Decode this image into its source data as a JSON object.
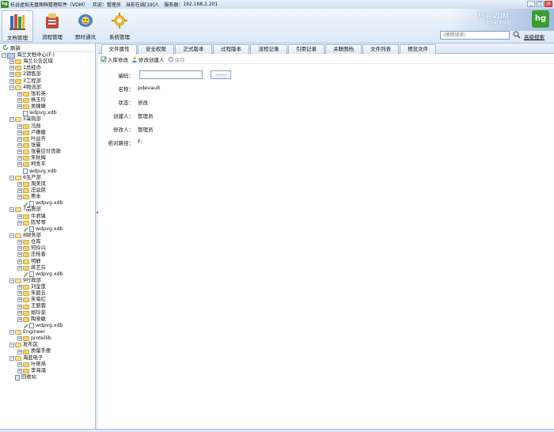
{
  "window": {
    "title": "杭谷虚拟无盘图档管理软件（VDM）",
    "welcome": "欢迎：管理员",
    "online": "当前在线[19]人",
    "server_label": "服务器：",
    "server": "192.168.2.201",
    "min": "_",
    "max": "□",
    "close": "×"
  },
  "toolbar": {
    "buttons": [
      {
        "label": "文档管理",
        "icon": "books-icon"
      },
      {
        "label": "流程管理",
        "icon": "flow-icon"
      },
      {
        "label": "即时通讯",
        "icon": "chat-icon"
      },
      {
        "label": "系统管理",
        "icon": "system-icon"
      }
    ],
    "brand_name": "杭谷VDM",
    "brand_sub": "智能新 新体验",
    "brand_logo": "hg",
    "search_placeholder": "(模糊搜索)",
    "advanced_search": "高级搜索"
  },
  "left": {
    "refresh": "刷新"
  },
  "tree": [
    {
      "level": 0,
      "label": "海兰文档中心(F:)",
      "type": "root",
      "exp": "-"
    },
    {
      "level": 1,
      "label": "海兰公告区域",
      "type": "folder",
      "exp": "+"
    },
    {
      "level": 1,
      "label": "1总经办",
      "type": "folder",
      "exp": "+"
    },
    {
      "level": 1,
      "label": "2销售部",
      "type": "folder",
      "exp": "+"
    },
    {
      "level": 1,
      "label": "3工程部",
      "type": "folder",
      "exp": "+"
    },
    {
      "level": 1,
      "label": "4物流部",
      "type": "folder-open",
      "exp": "-"
    },
    {
      "level": 2,
      "label": "张彩英",
      "type": "folder",
      "exp": "+"
    },
    {
      "level": 2,
      "label": "杨玉玲",
      "type": "folder",
      "exp": "+"
    },
    {
      "level": 2,
      "label": "吴婕婕",
      "type": "folder",
      "exp": "+"
    },
    {
      "level": 2,
      "label": "wdpvg.xdb",
      "type": "doc",
      "exp": ""
    },
    {
      "level": 1,
      "label": "5采购部",
      "type": "folder-open",
      "exp": "-"
    },
    {
      "level": 2,
      "label": "冯勋",
      "type": "folder",
      "exp": "+"
    },
    {
      "level": 2,
      "label": "卢嫩媛",
      "type": "folder",
      "exp": "+"
    },
    {
      "level": 2,
      "label": "叶益芳",
      "type": "folder",
      "exp": "+"
    },
    {
      "level": 2,
      "label": "张曼",
      "type": "folder",
      "exp": "+"
    },
    {
      "level": 2,
      "label": "张曼应付货款",
      "type": "folder",
      "exp": "+"
    },
    {
      "level": 2,
      "label": "朱秋梅",
      "type": "folder",
      "exp": "+"
    },
    {
      "level": 2,
      "label": "柯秀平",
      "type": "folder",
      "exp": "+"
    },
    {
      "level": 2,
      "label": "wdpvg.xdb",
      "type": "doc",
      "exp": ""
    },
    {
      "level": 1,
      "label": "6生产部",
      "type": "folder-open",
      "exp": "-"
    },
    {
      "level": 2,
      "label": "周美凤",
      "type": "folder",
      "exp": "+"
    },
    {
      "level": 2,
      "label": "庄益民",
      "type": "folder",
      "exp": "+"
    },
    {
      "level": 2,
      "label": "票本",
      "type": "folder",
      "exp": "+"
    },
    {
      "level": 2,
      "label": "wdpvg.xdb",
      "type": "pencil-doc",
      "exp": ""
    },
    {
      "level": 1,
      "label": "7品质部",
      "type": "folder-open",
      "exp": "-"
    },
    {
      "level": 2,
      "label": "牛君锋",
      "type": "folder",
      "exp": "+"
    },
    {
      "level": 2,
      "label": "陈琴琴",
      "type": "folder",
      "exp": "+"
    },
    {
      "level": 2,
      "label": "wdpvg.xdb",
      "type": "pencil-doc",
      "exp": ""
    },
    {
      "level": 1,
      "label": "8财务部",
      "type": "folder-open",
      "exp": "-"
    },
    {
      "level": 2,
      "label": "仓库",
      "type": "folder",
      "exp": "+"
    },
    {
      "level": 2,
      "label": "何伶兴",
      "type": "folder",
      "exp": "+"
    },
    {
      "level": 2,
      "label": "庄桂香",
      "type": "folder",
      "exp": "+"
    },
    {
      "level": 2,
      "label": "明静",
      "type": "folder",
      "exp": "+"
    },
    {
      "level": 2,
      "label": "蒋艺芬",
      "type": "folder",
      "exp": "+"
    },
    {
      "level": 2,
      "label": "wdpvg.xdb",
      "type": "pencil-doc",
      "exp": ""
    },
    {
      "level": 1,
      "label": "9行政部",
      "type": "folder-open",
      "exp": "-"
    },
    {
      "level": 2,
      "label": "刘金莲",
      "type": "folder",
      "exp": "+"
    },
    {
      "level": 2,
      "label": "朱碧云",
      "type": "folder",
      "exp": "+"
    },
    {
      "level": 2,
      "label": "朱菊红",
      "type": "folder",
      "exp": "+"
    },
    {
      "level": 2,
      "label": "王丽蓉",
      "type": "folder",
      "exp": "+"
    },
    {
      "level": 2,
      "label": "胡玲荣",
      "type": "folder",
      "exp": "+"
    },
    {
      "level": 2,
      "label": "陶晓敏",
      "type": "folder",
      "exp": "+"
    },
    {
      "level": 2,
      "label": "wdpvg.xdb",
      "type": "pencil-doc",
      "exp": ""
    },
    {
      "level": 1,
      "label": "Engineer",
      "type": "folder-open",
      "exp": "-"
    },
    {
      "level": 2,
      "label": "protellib",
      "type": "folder",
      "exp": "+"
    },
    {
      "level": 1,
      "label": "发布区",
      "type": "folder-open",
      "exp": "-"
    },
    {
      "level": 2,
      "label": "质量手册",
      "type": "folder",
      "exp": "+"
    },
    {
      "level": 1,
      "label": "海蓝电子",
      "type": "folder-open",
      "exp": "-"
    },
    {
      "level": 2,
      "label": "叶艳燕",
      "type": "folder",
      "exp": "+"
    },
    {
      "level": 2,
      "label": "李海涌",
      "type": "folder",
      "exp": "+"
    },
    {
      "level": 1,
      "label": "回收站",
      "type": "recycle",
      "exp": ""
    }
  ],
  "tabs": [
    {
      "label": "文件属性"
    },
    {
      "label": "安全权限"
    },
    {
      "label": "正式版本"
    },
    {
      "label": "过程版本"
    },
    {
      "label": "流程记录"
    },
    {
      "label": "引用记录"
    },
    {
      "label": "关联图档"
    },
    {
      "label": "文件列表"
    },
    {
      "label": "预览文件"
    }
  ],
  "actions": {
    "save_in": "入库修改",
    "edit_creator": "修改创建人",
    "save": "保存"
  },
  "form": {
    "code_label": "编码：",
    "code_value": "",
    "browse": "……",
    "name_label": "名称：",
    "name_value": "pdevault",
    "status_label": "状态：",
    "status_value": "修改",
    "creator_label": "创建人：",
    "creator_value": "管理员",
    "modifier_label": "修改人：",
    "modifier_value": "管理员",
    "path_label": "绝对路径：",
    "path_value": "F:"
  },
  "colors": {
    "chrome": "#dbe8f6",
    "border": "#a9c0dd",
    "brand_green": "#3a9c2f",
    "folder": "#f3d36a"
  }
}
